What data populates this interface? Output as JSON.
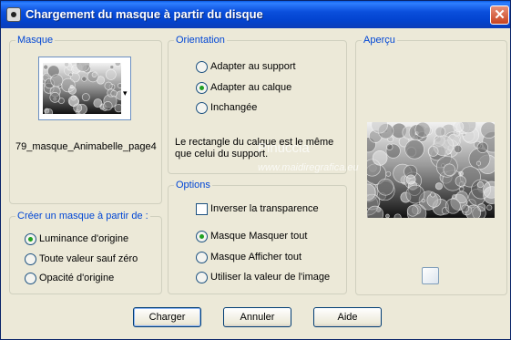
{
  "window": {
    "title": "Chargement du masque à partir du disque",
    "close_symbol": "✕"
  },
  "mask_group": {
    "label": "Masque",
    "mask_name": "79_masque_Animabelle_page4",
    "dropdown_arrow": "▾"
  },
  "orientation_group": {
    "label": "Orientation",
    "options": [
      "Adapter au support",
      "Adapter au calque",
      "Inchangée"
    ],
    "selected_index": 1,
    "note_line1": "Le rectangle du calque est le même",
    "note_line2": "que celui du support."
  },
  "preview_group": {
    "label": "Aperçu"
  },
  "create_group": {
    "label": "Créer un masque à partir de :",
    "options": [
      "Luminance d'origine",
      "Toute valeur sauf zéro",
      "Opacité d'origine"
    ],
    "selected_index": 0
  },
  "options_group": {
    "label": "Options",
    "invert_label": "Inverser la transparence",
    "invert_checked": false,
    "options": [
      "Masque Masquer tout",
      "Masque Afficher tout",
      "Utiliser la valeur de l'image"
    ],
    "selected_index": 0
  },
  "buttons": {
    "load": "Charger",
    "cancel": "Annuler",
    "help": "Aide"
  },
  "watermark": {
    "name": "Pinuccia",
    "site": "www.maidiregrafica.eu"
  }
}
